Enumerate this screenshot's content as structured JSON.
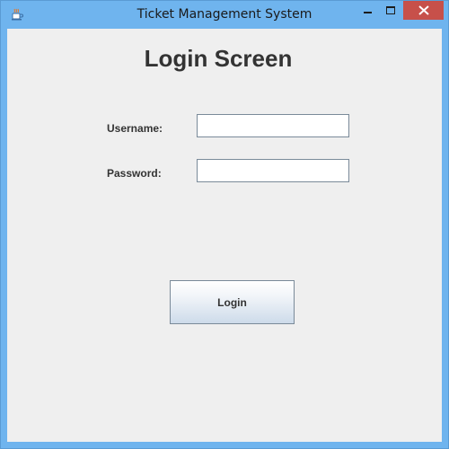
{
  "window": {
    "title": "Ticket Management System",
    "icon": "java-coffee-cup-icon",
    "controls": {
      "minimize_icon": "minimize-icon",
      "maximize_icon": "maximize-icon",
      "close_icon": "close-icon",
      "close_color": "#c7504a"
    },
    "titlebar_color": "#6fb4ee"
  },
  "login_form": {
    "heading": "Login Screen",
    "username_label": "Username:",
    "username_value": "",
    "password_label": "Password:",
    "password_value": "",
    "login_button_label": "Login"
  }
}
